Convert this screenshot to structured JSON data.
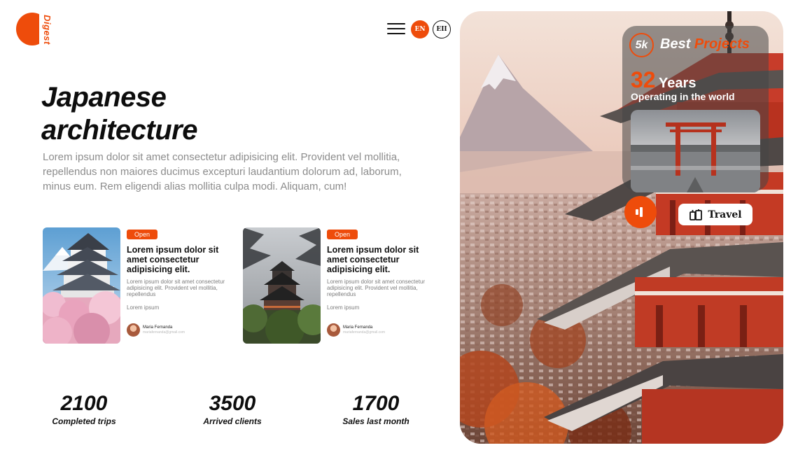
{
  "brand": {
    "name": "Digest",
    "accent": "#ee4c0b"
  },
  "nav": {
    "menu_icon": "hamburger-menu-icon",
    "lang_primary": "EN",
    "lang_secondary": "EII"
  },
  "hero": {
    "title_line1": "Japanese",
    "title_line2": "architecture",
    "description": "Lorem ipsum dolor sit amet consectetur adipisicing elit. Provident vel mollitia, repellendus non maiores ducimus excepturi laudantium dolorum ad, laborum, minus eum. Rem eligendi alias mollitia culpa modi. Aliquam, cum!"
  },
  "cards": [
    {
      "badge": "Open",
      "title": "Lorem ipsum dolor sit amet consectetur adipisicing elit.",
      "description": "Lorem ipsum dolor sit amet consectetur adipisicing elit. Provident vel mollitia, repellendus",
      "tag": "Lorem ipsum",
      "author_name": "Maria Fernanda",
      "author_email": "mariafernanda@gmail.com"
    },
    {
      "badge": "Open",
      "title": "Lorem ipsum dolor sit amet consectetur adipisicing elit.",
      "description": "Lorem ipsum dolor sit amet consectetur adipisicing elit. Provident vel mollitia, repellendus",
      "tag": "Lorem ipsum",
      "author_name": "Maria Fernanda",
      "author_email": "mariafernanda@gmail.com"
    }
  ],
  "stats": [
    {
      "value": "2100",
      "label": "Completed trips"
    },
    {
      "value": "3500",
      "label": "Arrived clients"
    },
    {
      "value": "1700",
      "label": "Sales last month"
    }
  ],
  "overlay": {
    "badge": "5k",
    "best": "Best",
    "projects": "Projects",
    "years_num": "32",
    "years_label": "Years",
    "operating": "Operating in the world",
    "travel_label": "Travel",
    "play_icon": "audio-play-icon",
    "travel_icon": "luggage-icon"
  }
}
